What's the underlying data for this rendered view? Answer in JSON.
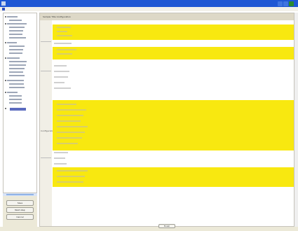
{
  "window": {
    "title": "",
    "buttons": [
      "minimize-icon",
      "maximize-icon",
      "close-icon"
    ],
    "title_color": "#1f57d4",
    "close_color": "#2a8a2f"
  },
  "menubar": {
    "icon": "app-menu-icon"
  },
  "sidebar": {
    "buttons": [
      {
        "label": "Save"
      },
      {
        "label": "Next step"
      },
      {
        "label": "Cancel"
      }
    ]
  },
  "content": {
    "title": "Sample Title Configuration",
    "row_label": "Configuration"
  },
  "status": {
    "button": "Finish"
  },
  "colors": {
    "highlight": "#f8e810",
    "panel": "#ddd8c7",
    "selection": "#5b6bbf"
  }
}
